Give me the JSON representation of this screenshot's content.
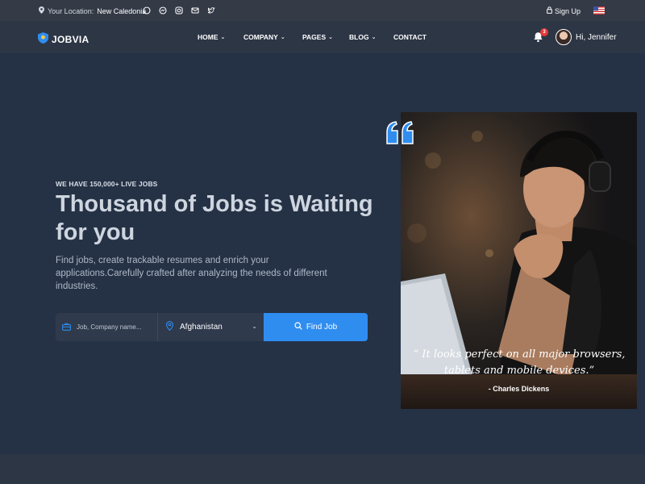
{
  "topbar": {
    "location_label": "Your Location:",
    "location_value": "New Caledonia",
    "social_icons": [
      "whatsapp-icon",
      "messenger-icon",
      "instagram-icon",
      "email-icon",
      "twitter-icon"
    ],
    "signup_label": "Sign Up"
  },
  "navbar": {
    "logo_text": "JOBVIA",
    "items": [
      {
        "label": "HOME",
        "has_dropdown": true
      },
      {
        "label": "COMPANY",
        "has_dropdown": true
      },
      {
        "label": "PAGES",
        "has_dropdown": true
      },
      {
        "label": "BLOG",
        "has_dropdown": true
      },
      {
        "label": "CONTACT",
        "has_dropdown": false
      }
    ],
    "notification_count": "3",
    "greeting": "Hi, Jennifer"
  },
  "hero": {
    "kicker": "WE HAVE 150,000+ LIVE JOBS",
    "title": "Thousand of Jobs is Waiting for you",
    "description": "Find jobs, create trackable resumes and enrich your applications.Carefully crafted after analyzing the needs of different industries."
  },
  "search": {
    "keyword_placeholder": "Job, Company name...",
    "location_value": "Afghanistan",
    "button_label": "Find Job"
  },
  "testimonial": {
    "quote": "“ It looks perfect on all major browsers, tablets and mobile devices.”",
    "author": "- Charles Dickens"
  },
  "colors": {
    "background": "#253246",
    "topbar": "#343a46",
    "navbar": "#2d3645",
    "accent": "#2f8df0",
    "badge": "#e53a3a"
  }
}
